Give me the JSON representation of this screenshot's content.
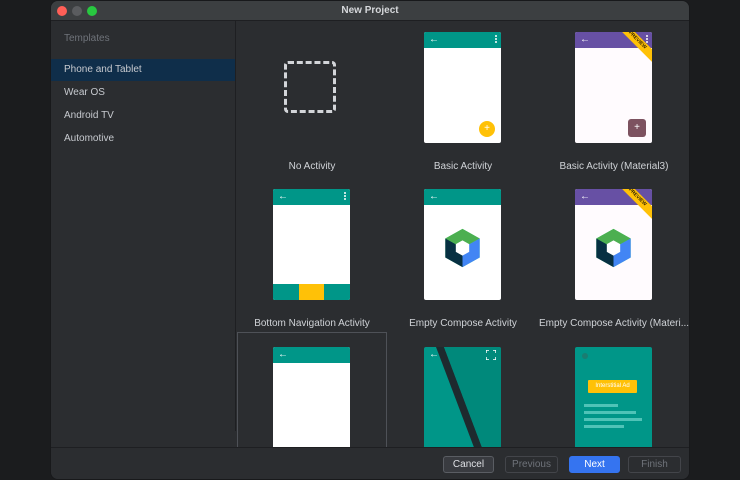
{
  "window": {
    "title": "New Project"
  },
  "sidebar": {
    "heading": "Templates",
    "items": [
      {
        "label": "Phone and Tablet",
        "selected": true
      },
      {
        "label": "Wear OS",
        "selected": false
      },
      {
        "label": "Android TV",
        "selected": false
      },
      {
        "label": "Automotive",
        "selected": false
      }
    ]
  },
  "templates": [
    {
      "label": "No Activity"
    },
    {
      "label": "Basic Activity"
    },
    {
      "label": "Basic Activity (Material3)",
      "badge": "PREVIEW"
    },
    {
      "label": "Bottom Navigation Activity"
    },
    {
      "label": "Empty Compose Activity"
    },
    {
      "label": "Empty Compose Activity (Materi...",
      "badge": "PREVIEW"
    },
    {
      "label": ""
    },
    {
      "label": ""
    },
    {
      "label": "",
      "ad_text": "Interstitial Ad"
    }
  ],
  "icons": {
    "back": "←",
    "fab_plus": "+"
  },
  "footer": {
    "cancel": "Cancel",
    "previous": "Previous",
    "next": "Next",
    "finish": "Finish"
  },
  "colors": {
    "accent": "#3574f0",
    "teal": "#009688",
    "material3_purple": "#6750a4",
    "amber": "#ffc107"
  }
}
